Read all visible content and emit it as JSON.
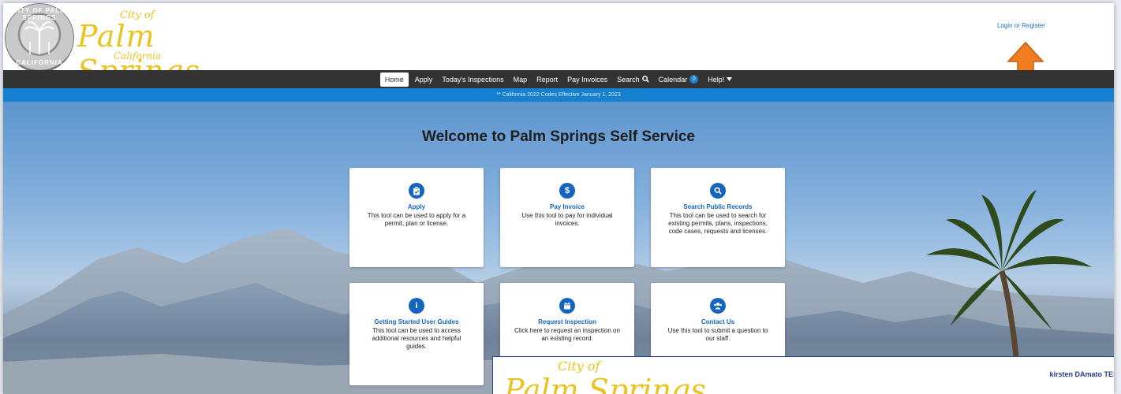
{
  "header": {
    "seal": {
      "top_text": "CITY OF PALM SPRINGS",
      "bottom_text": "CALIFORNIA"
    },
    "logo": {
      "city": "City of",
      "name": "Palm Springs",
      "state": "California"
    },
    "login_link": "Login or Register"
  },
  "nav": {
    "items": [
      {
        "label": "Home",
        "active": true
      },
      {
        "label": "Apply"
      },
      {
        "label": "Today's Inspections"
      },
      {
        "label": "Map"
      },
      {
        "label": "Report"
      },
      {
        "label": "Pay Invoices"
      },
      {
        "label": "Search"
      },
      {
        "label": "Calendar",
        "badge": "0"
      },
      {
        "label": "Help!"
      }
    ]
  },
  "banner": {
    "text": "** California 2022 Codes Effective January 1, 2023"
  },
  "hero": {
    "title": "Welcome to Palm Springs Self Service"
  },
  "cards": [
    {
      "icon": "clipboard-check-icon",
      "title": "Apply",
      "desc": "This tool can be used to apply for a permit, plan or license."
    },
    {
      "icon": "dollar-icon",
      "title": "Pay Invoice",
      "desc": "Use this tool to pay for individual invoices."
    },
    {
      "icon": "search-icon",
      "title": "Search Public Records",
      "desc": "This tool can be used to search for existing permits, plans, inspections, code cases, requests and licenses."
    },
    {
      "icon": "info-icon",
      "title": "Getting Started User Guides",
      "desc": "This tool can be used to access additional resources and helpful guides."
    },
    {
      "icon": "calendar-icon",
      "title": "Request Inspection",
      "desc": "Click here to request an inspection on an existing record."
    },
    {
      "icon": "users-icon",
      "title": "Contact Us",
      "desc": "Use this tool to submit a question to our staff."
    }
  ],
  "overlay": {
    "logo": {
      "city": "City of",
      "name": "Palm Springs"
    },
    "user": "kirsten DAmato TES"
  },
  "colors": {
    "brand_yellow": "#e9c31f",
    "nav_dark": "#333333",
    "banner_blue": "#1580d0",
    "link_blue": "#1565c0",
    "arrow_orange": "#f07c22"
  }
}
